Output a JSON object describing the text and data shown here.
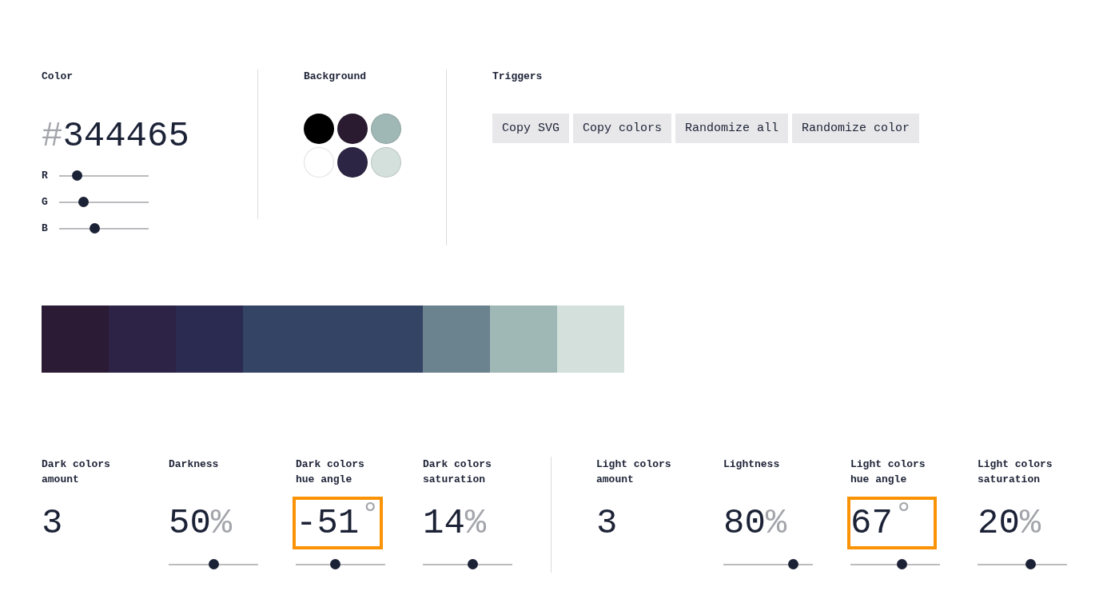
{
  "color": {
    "heading": "Color",
    "prefix": "#",
    "hex": "344465",
    "channels": [
      {
        "label": "R",
        "level": 0.2
      },
      {
        "label": "G",
        "level": 0.27
      },
      {
        "label": "B",
        "level": 0.4
      }
    ]
  },
  "background": {
    "heading": "Background",
    "swatches": [
      {
        "color": "#000000"
      },
      {
        "color": "#2a1b31"
      },
      {
        "color": "#a0b8b5"
      },
      {
        "color": "#ffffff"
      },
      {
        "color": "#2c2544"
      },
      {
        "color": "#d4e0dc"
      }
    ]
  },
  "triggers": {
    "heading": "Triggers",
    "buttons": [
      "Copy SVG",
      "Copy colors",
      "Randomize all",
      "Randomize color"
    ]
  },
  "palette": [
    {
      "color": "#2b1b34",
      "base": false
    },
    {
      "color": "#2d2346",
      "base": false
    },
    {
      "color": "#2b2b52",
      "base": false
    },
    {
      "color": "#344465",
      "base": true
    },
    {
      "color": "#6b838f",
      "base": false
    },
    {
      "color": "#a0b8b5",
      "base": false
    },
    {
      "color": "#d4e0dc",
      "base": false
    }
  ],
  "settings": [
    [
      {
        "label": "Dark colors amount",
        "kind": "number",
        "value": "3",
        "highlighted": false
      },
      {
        "label": "Darkness",
        "kind": "slider",
        "value": "50",
        "unit": "%",
        "level": 0.5,
        "highlighted": false
      },
      {
        "label": "Dark colors hue angle",
        "kind": "slider",
        "value": "-51",
        "unit": "°",
        "level": 0.44,
        "highlighted": true
      },
      {
        "label": "Dark colors saturation",
        "kind": "slider",
        "value": "14",
        "unit": "%",
        "level": 0.56,
        "highlighted": false
      }
    ],
    [
      {
        "label": "Light colors amount",
        "kind": "number",
        "value": "3",
        "highlighted": false
      },
      {
        "label": "Lightness",
        "kind": "slider",
        "value": "80",
        "unit": "%",
        "level": 0.78,
        "highlighted": false
      },
      {
        "label": "Light colors hue angle",
        "kind": "slider",
        "value": "67",
        "unit": "°",
        "level": 0.58,
        "highlighted": true
      },
      {
        "label": "Light colors saturation",
        "kind": "slider",
        "value": "20",
        "unit": "%",
        "level": 0.59,
        "highlighted": false
      }
    ]
  ]
}
